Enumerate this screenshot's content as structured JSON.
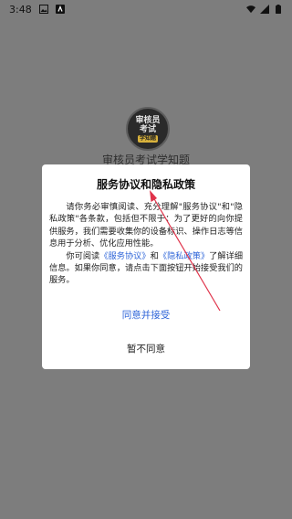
{
  "status_bar": {
    "time": "3:48"
  },
  "splash": {
    "logo_line1": "审核员",
    "logo_line2": "考试",
    "logo_badge": "学知题",
    "app_name": "审核员考试学知题"
  },
  "dialog": {
    "title": "服务协议和隐私政策",
    "paragraph1": "请你务必审慎阅读、充分理解\"服务协议\"和\"隐私政策\"各条款，包括但不限于：为了更好的向你提供服务，我们需要收集你的设备标识、操作日志等信息用于分析、优化应用性能。",
    "p2_prefix": "你可阅读",
    "service_link": "《服务协议》",
    "p2_and": "和",
    "privacy_link": "《隐私政策》",
    "p2_suffix": "了解详细信息。如果你同意，请点击下面按钮开始接受我们的服务。",
    "agree_label": "同意并接受",
    "disagree_label": "暂不同意"
  },
  "colors": {
    "accent": "#2d64d8",
    "scrim": "#7d7d7d",
    "arrow": "#e0334a"
  }
}
